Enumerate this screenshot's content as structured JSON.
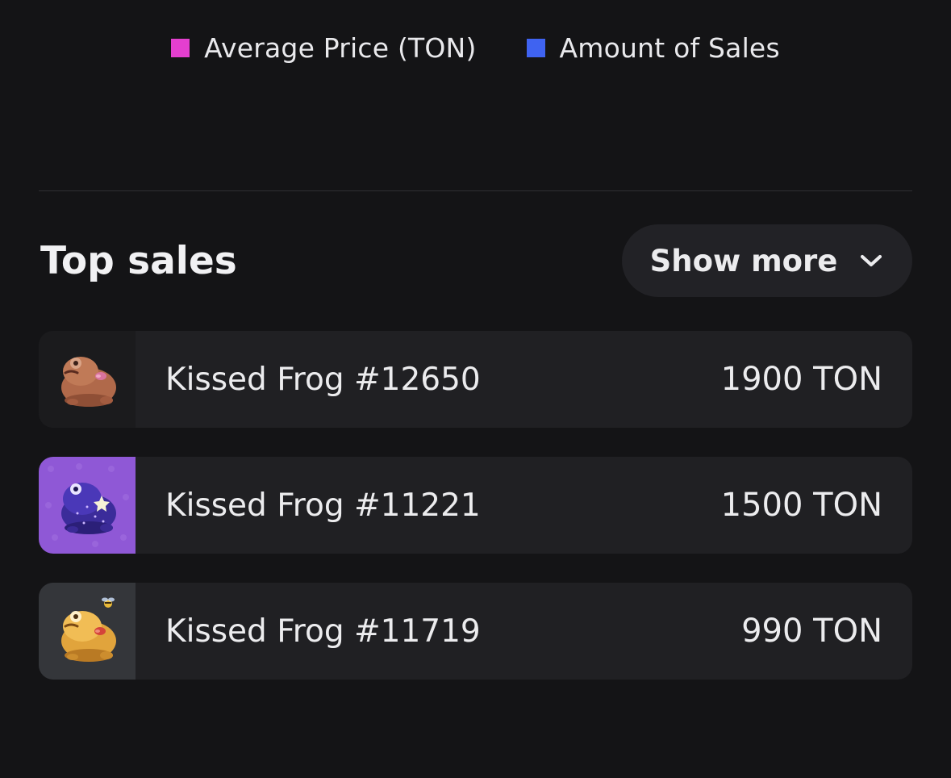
{
  "legend": {
    "items": [
      {
        "label": "Average Price (TON)",
        "color": "#e43fcf"
      },
      {
        "label": "Amount of Sales",
        "color": "#3f63f1"
      }
    ]
  },
  "top_sales": {
    "title": "Top sales",
    "show_more_label": "Show more",
    "show_more_icon": "chevron-down-icon",
    "items": [
      {
        "name": "Kissed Frog #12650",
        "price": "1900 TON",
        "icon": "brown-frog-icon",
        "bg": "#1b1b1d"
      },
      {
        "name": "Kissed Frog #11221",
        "price": "1500 TON",
        "icon": "purple-frog-icon",
        "bg": "#8f58d6"
      },
      {
        "name": "Kissed Frog #11719",
        "price": "990 TON",
        "icon": "gold-frog-icon",
        "bg": "#34363a"
      }
    ]
  }
}
